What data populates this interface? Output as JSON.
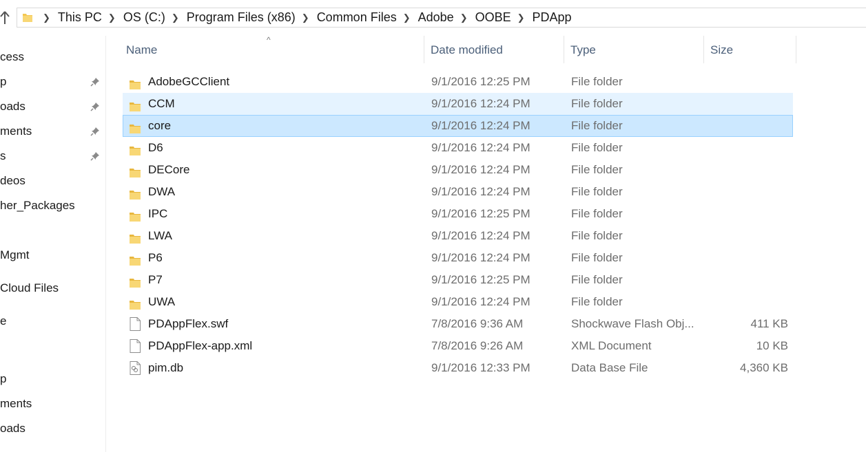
{
  "address_bar": {
    "crumbs": [
      "This PC",
      "OS (C:)",
      "Program Files (x86)",
      "Common Files",
      "Adobe",
      "OOBE",
      "PDApp"
    ]
  },
  "nav_pane": {
    "items": [
      {
        "label": "cess",
        "pinned": false
      },
      {
        "label": "p",
        "pinned": true
      },
      {
        "label": "oads",
        "pinned": true
      },
      {
        "label": "ments",
        "pinned": true
      },
      {
        "label": "s",
        "pinned": true
      },
      {
        "label": "deos",
        "pinned": false
      },
      {
        "label": "her_Packages",
        "pinned": false
      },
      {
        "label": "Mgmt",
        "pinned": false
      },
      {
        "label": "Cloud Files",
        "pinned": false
      },
      {
        "label": "e",
        "pinned": false
      },
      {
        "label": "p",
        "pinned": false
      },
      {
        "label": "ments",
        "pinned": false
      },
      {
        "label": "oads",
        "pinned": false
      }
    ]
  },
  "columns": {
    "name": "Name",
    "date_modified": "Date modified",
    "type": "Type",
    "size": "Size",
    "sort_indicator": "^"
  },
  "files": [
    {
      "name": "AdobeGCClient",
      "date": "9/1/2016 12:25 PM",
      "type": "File folder",
      "size": "",
      "icon": "folder-icon",
      "state": "normal"
    },
    {
      "name": "CCM",
      "date": "9/1/2016 12:24 PM",
      "type": "File folder",
      "size": "",
      "icon": "folder-icon",
      "state": "hover"
    },
    {
      "name": "core",
      "date": "9/1/2016 12:24 PM",
      "type": "File folder",
      "size": "",
      "icon": "folder-icon",
      "state": "selected"
    },
    {
      "name": "D6",
      "date": "9/1/2016 12:24 PM",
      "type": "File folder",
      "size": "",
      "icon": "folder-icon",
      "state": "normal"
    },
    {
      "name": "DECore",
      "date": "9/1/2016 12:24 PM",
      "type": "File folder",
      "size": "",
      "icon": "folder-icon",
      "state": "normal"
    },
    {
      "name": "DWA",
      "date": "9/1/2016 12:24 PM",
      "type": "File folder",
      "size": "",
      "icon": "folder-icon",
      "state": "normal"
    },
    {
      "name": "IPC",
      "date": "9/1/2016 12:25 PM",
      "type": "File folder",
      "size": "",
      "icon": "folder-icon",
      "state": "normal"
    },
    {
      "name": "LWA",
      "date": "9/1/2016 12:24 PM",
      "type": "File folder",
      "size": "",
      "icon": "folder-icon",
      "state": "normal"
    },
    {
      "name": "P6",
      "date": "9/1/2016 12:24 PM",
      "type": "File folder",
      "size": "",
      "icon": "folder-icon",
      "state": "normal"
    },
    {
      "name": "P7",
      "date": "9/1/2016 12:25 PM",
      "type": "File folder",
      "size": "",
      "icon": "folder-icon",
      "state": "normal"
    },
    {
      "name": "UWA",
      "date": "9/1/2016 12:24 PM",
      "type": "File folder",
      "size": "",
      "icon": "folder-icon",
      "state": "normal"
    },
    {
      "name": "PDAppFlex.swf",
      "date": "7/8/2016 9:36 AM",
      "type": "Shockwave Flash Obj...",
      "size": "411 KB",
      "icon": "file-icon",
      "state": "normal"
    },
    {
      "name": "PDAppFlex-app.xml",
      "date": "7/8/2016 9:26 AM",
      "type": "XML Document",
      "size": "10 KB",
      "icon": "file-icon",
      "state": "normal"
    },
    {
      "name": "pim.db",
      "date": "9/1/2016 12:33 PM",
      "type": "Data Base File",
      "size": "4,360 KB",
      "icon": "database-file-icon",
      "state": "normal"
    }
  ],
  "colors": {
    "hover_bg": "#e5f3ff",
    "selected_bg": "#cce8ff",
    "selected_border": "#99d1ff",
    "folder_yellow": "#f8d775",
    "header_text": "#4c607a"
  }
}
